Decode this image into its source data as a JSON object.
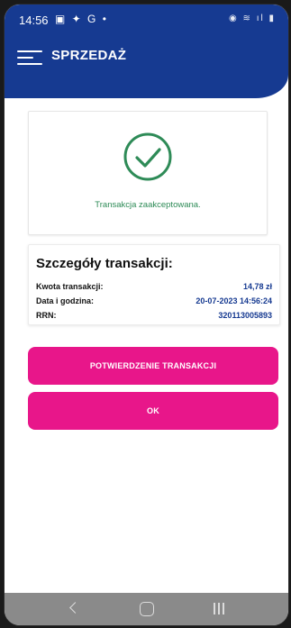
{
  "status_bar": {
    "time": "14:56",
    "left_icons": "▣ ✦ G •",
    "right_icons": "◉ ≋ ıl ▮"
  },
  "header": {
    "title": "SPRZEDAŻ",
    "background_color": "#163a91",
    "menu_icon": "hamburger-menu-icon"
  },
  "result": {
    "icon": "check-circle-icon",
    "icon_color": "#2e8b57",
    "message": "Transakcja zaakceptowana."
  },
  "details": {
    "title": "Szczegóły transakcji:",
    "rows": [
      {
        "label": "Kwota transakcji:",
        "value": "14,78 zł"
      },
      {
        "label": "Data i godzina:",
        "value": "20-07-2023 14:56:24"
      },
      {
        "label": "RRN:",
        "value": "320113005893"
      }
    ]
  },
  "buttons": {
    "confirm_label": "POTWIERDZENIE TRANSAKCJI",
    "ok_label": "OK",
    "color": "#e8168a"
  },
  "nav_bar": {
    "back_icon": "back-chevron-icon",
    "home_icon": "home-icon",
    "recent_icon": "recent-apps-icon"
  }
}
